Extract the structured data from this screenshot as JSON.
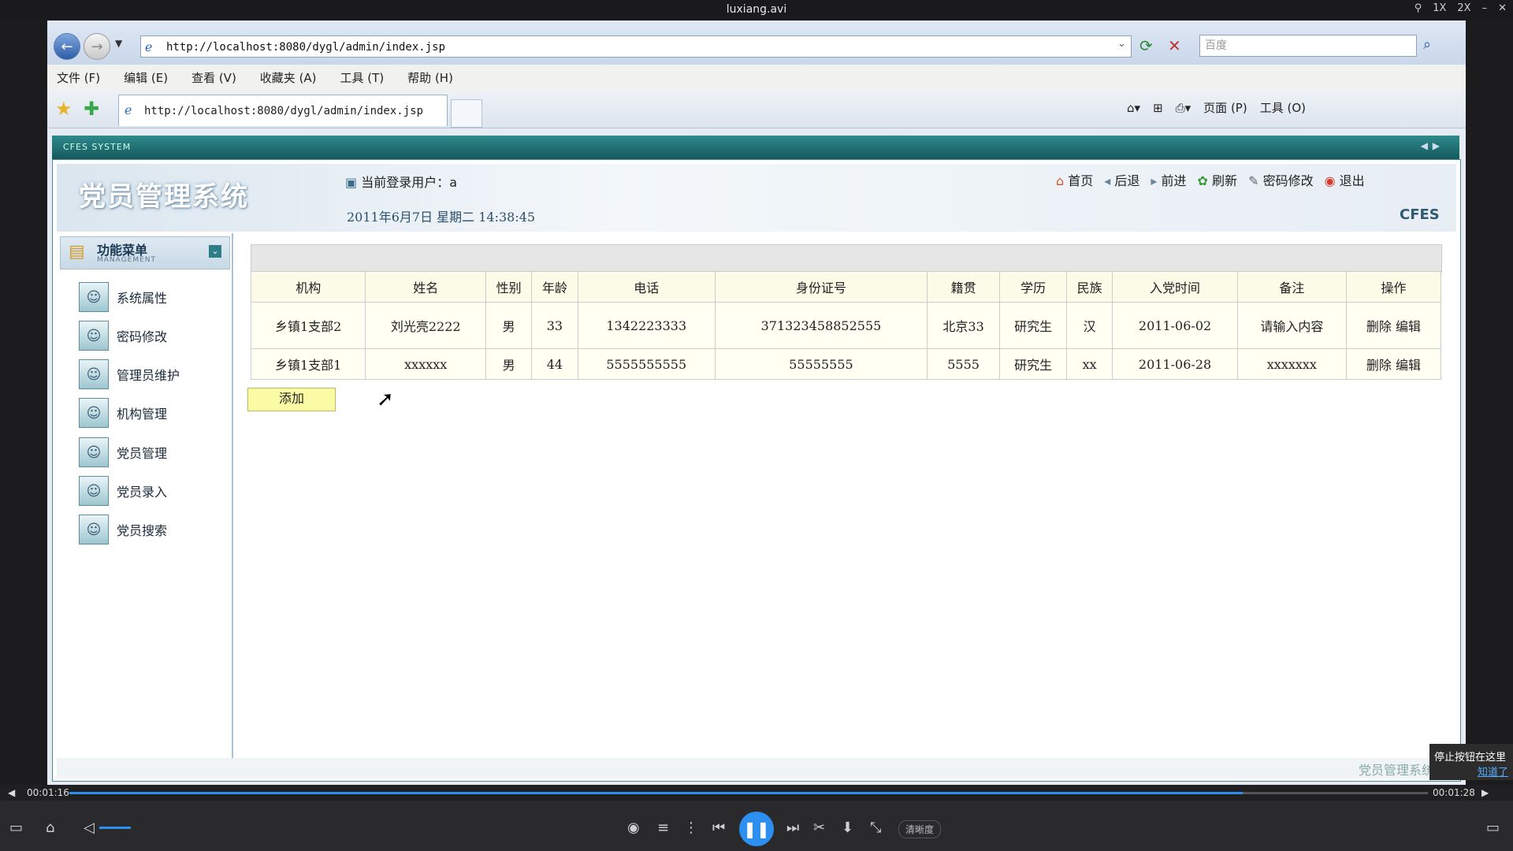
{
  "player": {
    "title": "luxiang.avi",
    "top_icons": [
      "1X",
      "2X"
    ],
    "time_current": "00:01:16",
    "time_total": "00:01:28",
    "progress": 0.8636,
    "clarity_label": "清晰度",
    "tooltip_text": "停止按钮在这里",
    "tooltip_link": "知道了"
  },
  "browser": {
    "url": "http://localhost:8080/dygl/admin/index.jsp",
    "search_placeholder": "百度",
    "menu": [
      "文件 (F)",
      "编辑 (E)",
      "查看 (V)",
      "收藏夹 (A)",
      "工具 (T)",
      "帮助 (H)"
    ],
    "tab_title": "http://localhost:8080/dygl/admin/index.jsp",
    "cmd_page": "页面 (P)",
    "cmd_tools": "工具 (O)"
  },
  "app": {
    "bar_label": "CFES SYSTEM",
    "logo": "党员管理系统",
    "current_user_label": "当前登录用户：a",
    "datetime": "2011年6月7日  星期二  14:38:45",
    "brand": "CFES",
    "top_links": [
      "首页",
      "后退",
      "前进",
      "刷新",
      "密码修改",
      "退出"
    ],
    "sidebar": {
      "title": "功能菜单",
      "subtitle": "MANAGEMENT",
      "items": [
        "系统属性",
        "密码修改",
        "管理员维护",
        "机构管理",
        "党员管理",
        "党员录入",
        "党员搜索"
      ]
    },
    "table": {
      "headers": [
        "机构",
        "姓名",
        "性别",
        "年龄",
        "电话",
        "身份证号",
        "籍贯",
        "学历",
        "民族",
        "入党时间",
        "备注",
        "操作"
      ],
      "rows": [
        [
          "乡镇1支部2",
          "刘光亮2222",
          "男",
          "33",
          "1342223333",
          "371323458852555",
          "北京33",
          "研究生",
          "汉",
          "2011-06-02",
          "请输入内容"
        ],
        [
          "乡镇1支部1",
          "xxxxxx",
          "男",
          "44",
          "5555555555",
          "55555555",
          "5555",
          "研究生",
          "xx",
          "2011-06-28",
          "xxxxxxx"
        ]
      ],
      "action_delete": "删除",
      "action_edit": "编辑"
    },
    "add_button": "添加",
    "footer": "党员管理系统"
  }
}
